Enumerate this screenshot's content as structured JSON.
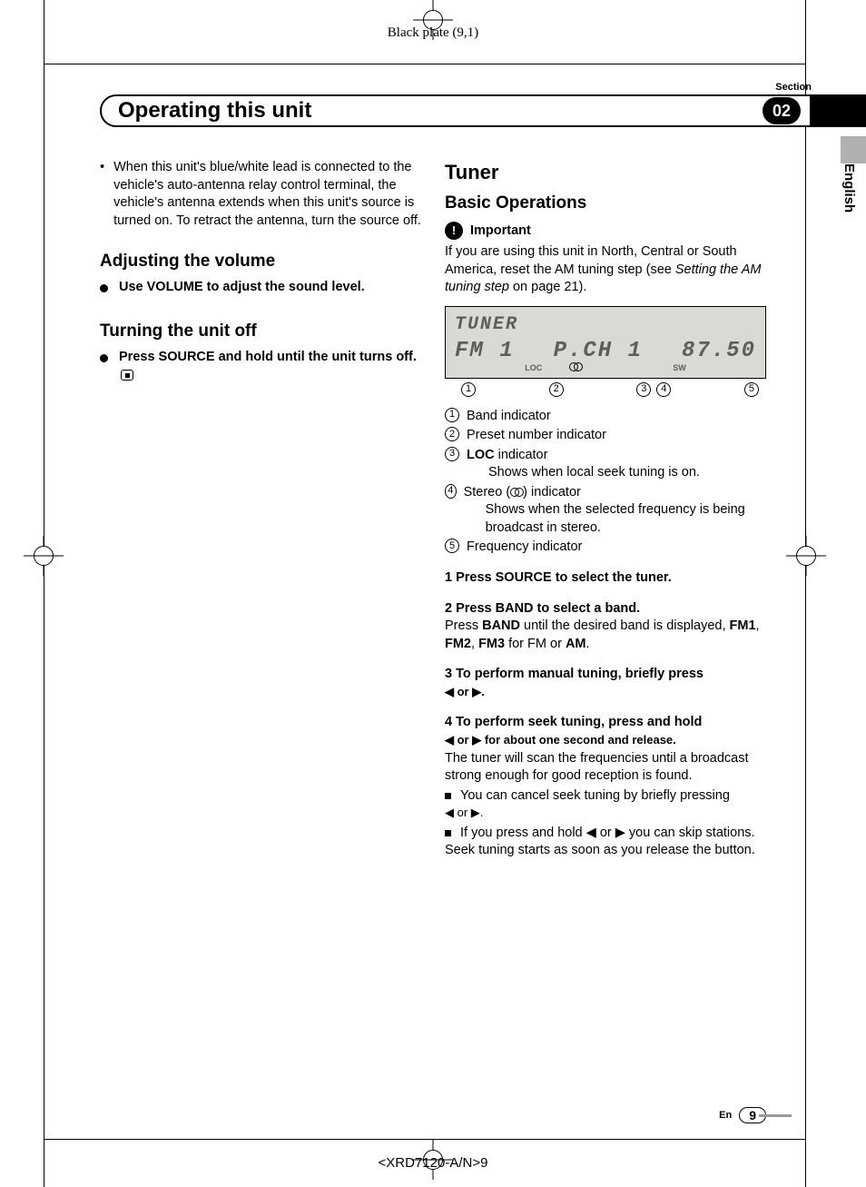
{
  "top_plate": "Black plate (9,1)",
  "bottom_code": "<XRD7120-A/N>9",
  "section_label": "Section",
  "section_number": "02",
  "header_title": "Operating this unit",
  "language": "English",
  "left": {
    "bullet1": "When this unit's blue/white lead is connected to the vehicle's auto-antenna relay control terminal, the vehicle's antenna extends when this unit's source is turned on. To retract the antenna, turn the source off.",
    "h_adjust": "Adjusting the volume",
    "adjust_step": "Use VOLUME to adjust the sound level.",
    "h_off": "Turning the unit off",
    "off_step": "Press SOURCE and hold until the unit turns off."
  },
  "right": {
    "h_tuner": "Tuner",
    "h_basic": "Basic Operations",
    "important_label": "Important",
    "important_body_a": "If you are using this unit in North, Central or South America, reset the AM tuning step (see ",
    "important_body_i": "Setting the AM tuning step",
    "important_body_b": " on page 21).",
    "lcd": {
      "line1": "TUNER",
      "band": "FM 1",
      "preset": "P.CH 1",
      "loc": "LOC",
      "sw": "SW",
      "freq": "87.50"
    },
    "callouts": [
      "1",
      "2",
      "3",
      "4",
      "5"
    ],
    "indicators": {
      "i1": "Band indicator",
      "i2": "Preset number indicator",
      "i3a": "LOC",
      "i3b": " indicator",
      "i3_sub": "Shows when local seek tuning is on.",
      "i4a": "Stereo (",
      "i4b": ") indicator",
      "i4_sub": "Shows when the selected frequency is being broadcast in stereo.",
      "i5": "Frequency indicator"
    },
    "steps": {
      "s1": "1   Press SOURCE to select the tuner.",
      "s2": "2   Press BAND to select a band.",
      "s2_body_a": "Press ",
      "s2_body_b": "BAND",
      "s2_body_c": " until the desired band is displayed, ",
      "s2_body_d": "FM1",
      "s2_body_e": ", ",
      "s2_body_f": "FM2",
      "s2_body_g": ", ",
      "s2_body_h": "FM3",
      "s2_body_i": " for FM or ",
      "s2_body_j": "AM",
      "s2_body_k": ".",
      "s3a": "3   To perform manual tuning, briefly press ",
      "s3b": "◀ or ▶.",
      "s4a": "4   To perform seek tuning, press and hold ",
      "s4b": "◀ or ▶ for about one second and release.",
      "s4_body": "The tuner will scan the frequencies until a broadcast strong enough for good reception is found.",
      "s4_n1a": "You can cancel seek tuning by briefly pressing ",
      "s4_n1b": "◀ or ▶.",
      "s4_n2a": "If you press and hold ◀ or ▶ you can skip stations. Seek tuning starts as soon as you release the button."
    }
  },
  "footer": {
    "lang_short": "En",
    "page": "9"
  }
}
